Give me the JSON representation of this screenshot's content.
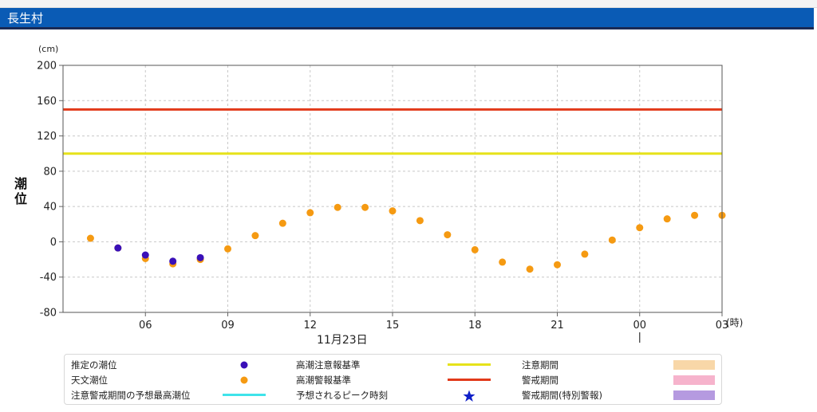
{
  "header": {
    "title": "長生村"
  },
  "colors": {
    "estimated": "#3a10b8",
    "astronomical": "#f59a12",
    "caution_line": "#e6e21a",
    "warning_line": "#e23a1a",
    "forecast_max": "#3fe3ea",
    "peak_star": "#1020c8",
    "caution_period": "#f8d7a8",
    "warning_period": "#f6b3cc",
    "special_period": "#b59ae0"
  },
  "chart_data": {
    "type": "scatter",
    "unit_label": "(cm)",
    "ylabel": "潮位",
    "x_unit_label": "(時)",
    "date_label": "11月23日",
    "ylim": [
      -80,
      200
    ],
    "y_ticks": [
      200,
      160,
      120,
      80,
      40,
      0,
      -40,
      -80
    ],
    "x_range_hours": [
      3,
      27
    ],
    "x_ticks": [
      {
        "hour": 6,
        "label": "06"
      },
      {
        "hour": 9,
        "label": "09"
      },
      {
        "hour": 12,
        "label": "12"
      },
      {
        "hour": 15,
        "label": "15"
      },
      {
        "hour": 18,
        "label": "18"
      },
      {
        "hour": 21,
        "label": "21"
      },
      {
        "hour": 24,
        "label": "00"
      },
      {
        "hour": 27,
        "label": "03"
      }
    ],
    "grid": true,
    "thresholds": [
      {
        "name": "高潮注意報基準",
        "value": 100
      },
      {
        "name": "高潮警報基準",
        "value": 150
      }
    ],
    "series": [
      {
        "name": "天文潮位",
        "x": [
          4,
          5,
          6,
          7,
          8,
          9,
          10,
          11,
          12,
          13,
          14,
          15,
          16,
          17,
          18,
          19,
          20,
          21,
          22,
          23,
          24,
          25,
          26,
          27
        ],
        "y": [
          4,
          -7,
          -19,
          -25,
          -20,
          -8,
          7,
          21,
          33,
          39,
          39,
          35,
          24,
          8,
          -9,
          -23,
          -31,
          -26,
          -14,
          2,
          16,
          26,
          30,
          30
        ]
      },
      {
        "name": "推定の潮位",
        "x": [
          5,
          6,
          7,
          8
        ],
        "y": [
          -7,
          -15,
          -22,
          -18
        ]
      }
    ]
  },
  "legend": {
    "items": [
      {
        "label": "推定の潮位",
        "symbol": "dot-estimated"
      },
      {
        "label": "高潮注意報基準",
        "symbol": "line-caution"
      },
      {
        "label": "注意期間",
        "symbol": "box-caution"
      },
      {
        "label": "天文潮位",
        "symbol": "dot-astronomical"
      },
      {
        "label": "高潮警報基準",
        "symbol": "line-warning"
      },
      {
        "label": "警戒期間",
        "symbol": "box-warning"
      },
      {
        "label": "注意警戒期間の予想最高潮位",
        "symbol": "line-forecast"
      },
      {
        "label": "予想されるピーク時刻",
        "symbol": "star"
      },
      {
        "label": "警戒期間(特別警報)",
        "symbol": "box-special"
      }
    ]
  }
}
